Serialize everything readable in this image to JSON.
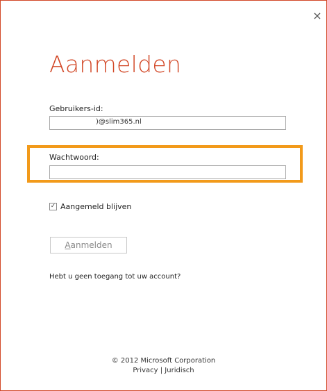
{
  "dialog": {
    "title": "Aanmelden",
    "close_symbol": "×"
  },
  "userid": {
    "label": "Gebruikers-id:",
    "value": ")@slim365.nl"
  },
  "password": {
    "label": "Wachtwoord:",
    "value": ""
  },
  "remember": {
    "label": "Aangemeld blijven",
    "checked": true,
    "check_symbol": "✓"
  },
  "signin_button": {
    "accesskey_letter": "A",
    "label_rest": "anmelden"
  },
  "no_access_link": "Hebt u geen toegang tot uw account?",
  "footer": {
    "copyright": "© 2012 Microsoft Corporation",
    "privacy": "Privacy",
    "separator": "|",
    "legal": "Juridisch"
  },
  "colors": {
    "accent": "#d24726",
    "highlight": "#f29a1a"
  },
  "icons": {
    "close": "close-icon",
    "check": "checkmark-icon"
  }
}
